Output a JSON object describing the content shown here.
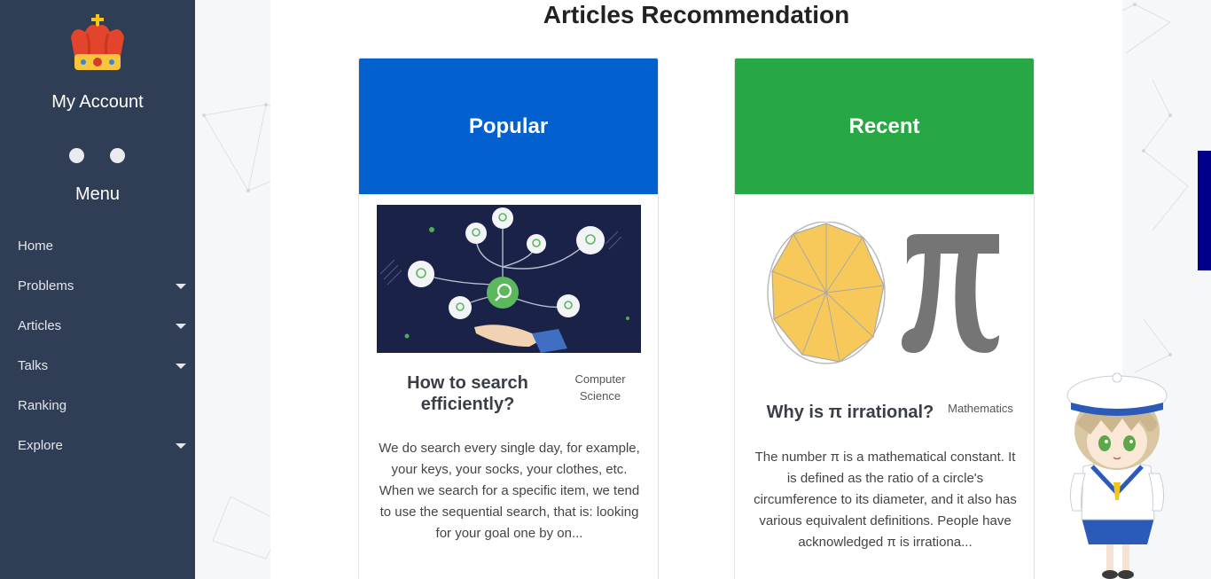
{
  "sidebar": {
    "account_title": "My Account",
    "menu_title": "Menu",
    "items": [
      {
        "label": "Home",
        "has_submenu": false
      },
      {
        "label": "Problems",
        "has_submenu": true
      },
      {
        "label": "Articles",
        "has_submenu": true
      },
      {
        "label": "Talks",
        "has_submenu": true
      },
      {
        "label": "Ranking",
        "has_submenu": false
      },
      {
        "label": "Explore",
        "has_submenu": true
      }
    ]
  },
  "main": {
    "title": "Articles Recommendation",
    "cards": [
      {
        "header": "Popular",
        "header_color": "#0360cf",
        "article_title": "How to search efficiently?",
        "tag": "Computer Science",
        "excerpt": "We do search every single day, for example, your keys, your socks, your clothes, etc. When we search for a specific item, we tend to use the sequential search, that is: looking for your goal one by on..."
      },
      {
        "header": "Recent",
        "header_color": "#28a745",
        "article_title": "Why is π irrational?",
        "tag": "Mathematics",
        "excerpt": "The number π is a mathematical constant. It is defined as the ratio of a circle's circumference to its diameter, and it also has various equivalent definitions. People have acknowledged π is irrationa..."
      }
    ]
  },
  "icons": {
    "crown": "crown-icon",
    "search_network": "search-network-illustration",
    "pi": "pi-illustration",
    "mascot": "anime-sailor-mascot"
  },
  "colors": {
    "sidebar_bg": "#2f3d55",
    "popular": "#0360cf",
    "recent": "#28a745",
    "side_tab": "#00008b"
  }
}
